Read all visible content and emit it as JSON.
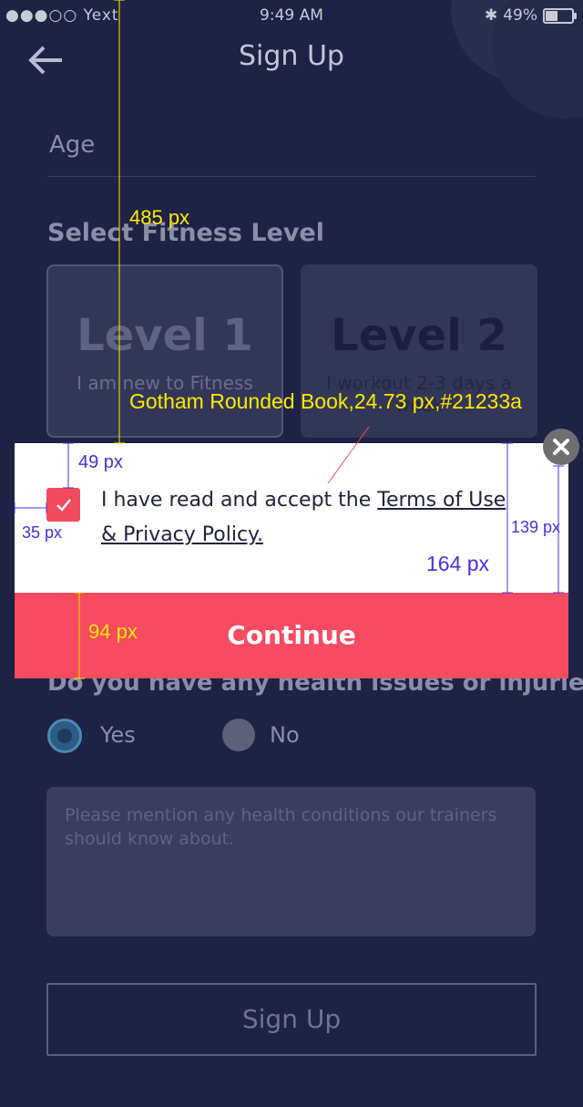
{
  "status_bar": {
    "carrier": "●●●○○ Yext",
    "time": "9:49 AM",
    "battery": "49%"
  },
  "header": {
    "title": "Sign Up"
  },
  "form": {
    "age_label": "Age",
    "fitness_label": "Select Fitness Level",
    "levels": [
      {
        "title": "Level 1",
        "desc": "I am new to Fitness"
      },
      {
        "title": "Level 2",
        "desc": "I workout 2-3 days a week"
      }
    ],
    "health_question": "Do you have any health issues or injuries",
    "options": {
      "yes": "Yes",
      "no": "No"
    },
    "health_placeholder": "Please mention any health conditions our trainers should know about.",
    "signup_button": "Sign Up"
  },
  "modal": {
    "accept_prefix": "I have read and accept the ",
    "accept_link": "Terms of Use & Privacy Policy.",
    "continue_button": "Continue",
    "checked": true
  },
  "annotations": {
    "dim_485": "485 px",
    "font_spec": "Gotham Rounded Book,24.73 px,#21233a",
    "dim_49": "49 px",
    "dim_35": "35 px",
    "dim_139": "139 px",
    "dim_164": "164 px",
    "dim_94": "94 px"
  },
  "colors": {
    "background": "#1e2244",
    "accent": "#f64b61",
    "text_dark": "#21233a",
    "annotation_yellow": "#ffea00",
    "annotation_blue": "#4b2fd8"
  }
}
